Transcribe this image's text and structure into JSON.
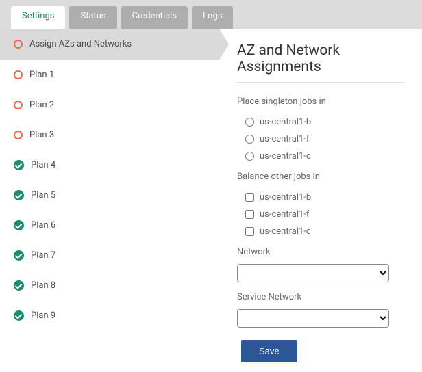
{
  "tabs": [
    "Settings",
    "Status",
    "Credentials",
    "Logs"
  ],
  "activeTab": 0,
  "sidebar": [
    {
      "label": "Assign AZs and Networks",
      "status": "pending",
      "active": true
    },
    {
      "label": "Plan 1",
      "status": "pending",
      "active": false
    },
    {
      "label": "Plan 2",
      "status": "pending",
      "active": false
    },
    {
      "label": "Plan 3",
      "status": "pending",
      "active": false
    },
    {
      "label": "Plan 4",
      "status": "done",
      "active": false
    },
    {
      "label": "Plan 5",
      "status": "done",
      "active": false
    },
    {
      "label": "Plan 6",
      "status": "done",
      "active": false
    },
    {
      "label": "Plan 7",
      "status": "done",
      "active": false
    },
    {
      "label": "Plan 8",
      "status": "done",
      "active": false
    },
    {
      "label": "Plan 9",
      "status": "done",
      "active": false
    }
  ],
  "main": {
    "title": "AZ and Network Assignments",
    "singleton": {
      "label": "Place singleton jobs in",
      "options": [
        "us-central1-b",
        "us-central1-f",
        "us-central1-c"
      ]
    },
    "balance": {
      "label": "Balance other jobs in",
      "options": [
        "us-central1-b",
        "us-central1-f",
        "us-central1-c"
      ]
    },
    "network_label": "Network",
    "service_network_label": "Service Network",
    "save_label": "Save"
  }
}
